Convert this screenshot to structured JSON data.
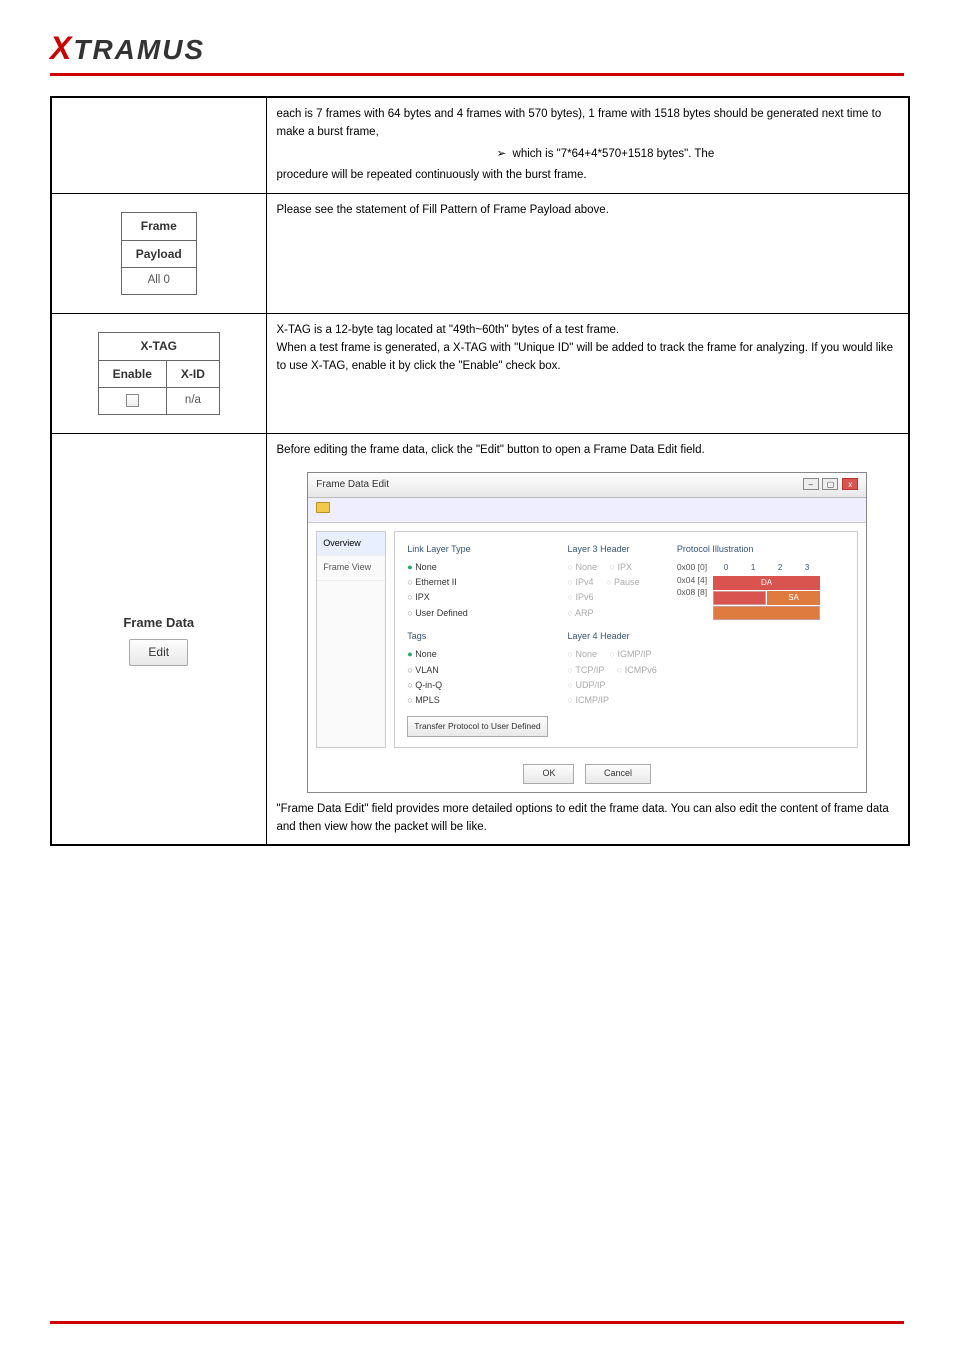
{
  "logo": {
    "prefix": "X",
    "rest": "TRAMUS"
  },
  "rows": {
    "r1": {
      "continued1": "each is 7 frames with 64 bytes and 4 frames with 570 bytes), 1 frame with 1518 bytes should be generated next time to make a burst frame,",
      "bullet": "which is \"7*64+4*570+1518 bytes\". The",
      "continued2": "procedure will be repeated continuously with the burst frame."
    },
    "r2": {
      "hdr1": "Frame",
      "hdr2": "Payload",
      "val": "All 0",
      "desc": "Please see the statement of Fill Pattern of Frame Payload above."
    },
    "r3": {
      "hdr": "X-TAG",
      "col1": "Enable",
      "col2": "X-ID",
      "val2": "n/a",
      "line1a": "X-TAG is a 12-byte tag located at ",
      "line1b": "49th~60th",
      "line1c": " bytes of a test frame.",
      "line2a": "When a test frame is generated, a X-TAG with ",
      "line2b": "Unique ID",
      "line2c": " will be added to track the frame for analyzing. If you would like to use X-TAG, enable it by click the ",
      "line2d": "Enable",
      "line2e": " check box."
    },
    "r4": {
      "label": "Frame Data",
      "btn": "Edit",
      "p1a": "Before editing the frame data, click the ",
      "p1b": "Edit",
      "p1c": " button to open a Frame Data Edit field.",
      "p2a": "",
      "p2b": "Frame Data Edit",
      "p2c": " field provides more detailed options to edit the frame data. You can also edit the content of frame data and then view how the packet will be like."
    }
  },
  "dialog": {
    "title": "Frame Data Edit",
    "tabs": {
      "overview": "Overview",
      "frameview": "Frame View"
    },
    "llt": {
      "title": "Link Layer Type",
      "none": "None",
      "eth": "Ethernet II",
      "ipx": "IPX",
      "ud": "User Defined"
    },
    "tags": {
      "title": "Tags",
      "none": "None",
      "vlan": "VLAN",
      "qinq": "Q-in-Q",
      "mpls": "MPLS",
      "xfer": "Transfer Protocol to User Defined"
    },
    "l3": {
      "title": "Layer 3 Header",
      "none": "None",
      "ipx": "IPX",
      "ipv4": "IPv4",
      "pause": "Pause",
      "ipv6": "IPv6",
      "arp": "ARP"
    },
    "l4": {
      "title": "Layer 4 Header",
      "none": "None",
      "igmp": "IGMP/IP",
      "tcp": "TCP/IP",
      "icmpv6": "ICMPv6",
      "udp": "UDP/IP",
      "icmp": "ICMP/IP"
    },
    "illus": {
      "title": "Protocol Illustration",
      "r0": "0x00 [0]",
      "r1": "0x04 [4]",
      "r2": "0x08 [8]",
      "da": "DA",
      "sa": "SA"
    },
    "footer": {
      "ok": "OK",
      "cancel": "Cancel"
    }
  }
}
